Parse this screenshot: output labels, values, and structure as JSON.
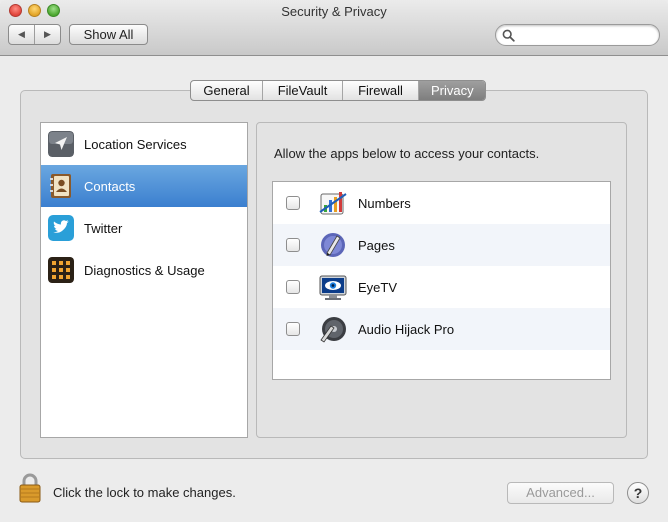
{
  "window": {
    "title": "Security & Privacy",
    "show_all_label": "Show All",
    "nav_back_glyph": "◀",
    "nav_forward_glyph": "▶",
    "search_placeholder": ""
  },
  "tabs": [
    {
      "label": "General",
      "selected": false
    },
    {
      "label": "FileVault",
      "selected": false
    },
    {
      "label": "Firewall",
      "selected": false
    },
    {
      "label": "Privacy",
      "selected": true
    }
  ],
  "sidebar": {
    "items": [
      {
        "label": "Location Services",
        "icon": "location-arrow-icon",
        "selected": false
      },
      {
        "label": "Contacts",
        "icon": "contacts-book-icon",
        "selected": true
      },
      {
        "label": "Twitter",
        "icon": "twitter-bird-icon",
        "selected": false
      },
      {
        "label": "Diagnostics & Usage",
        "icon": "diagnostics-grid-icon",
        "selected": false
      }
    ]
  },
  "panel": {
    "description": "Allow the apps below to access your contacts.",
    "apps": [
      {
        "label": "Numbers",
        "icon": "numbers-app-icon",
        "checked": false
      },
      {
        "label": "Pages",
        "icon": "pages-app-icon",
        "checked": false
      },
      {
        "label": "EyeTV",
        "icon": "eyetv-app-icon",
        "checked": false
      },
      {
        "label": "Audio Hijack Pro",
        "icon": "audio-hijack-app-icon",
        "checked": false
      }
    ]
  },
  "footer": {
    "lock_text": "Click the lock to make changes.",
    "advanced_label": "Advanced...",
    "help_label": "?"
  },
  "colors": {
    "selection_blue": "#3b7fcf",
    "window_bg": "#ececec",
    "panel_bg": "#e3e3e3"
  }
}
